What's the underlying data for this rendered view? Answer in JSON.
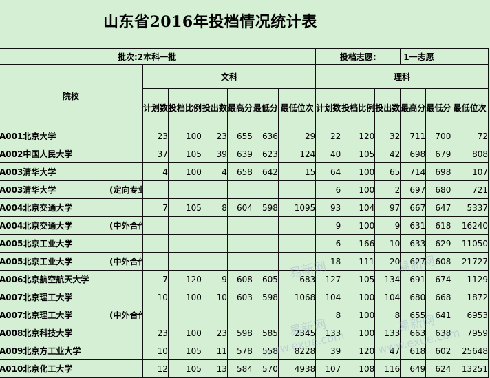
{
  "title": "山东省2016年投档情况统计表",
  "batch_label": "批次:2本科一批",
  "volunteer_label": "投档志愿:",
  "volunteer_value": "1一志愿",
  "school_header": "院校",
  "group_wenke": "文科",
  "group_like": "理科",
  "sub_headers": [
    "计划数",
    "投档比例",
    "投出数",
    "最高分",
    "最低分",
    "最低位次"
  ],
  "watermarks": [
    "易新网",
    "www.exue.com"
  ],
  "rows": [
    {
      "school": "A001北京大学",
      "note": "",
      "w": [
        "23",
        "100",
        "23",
        "655",
        "636",
        "29"
      ],
      "l": [
        "22",
        "120",
        "32",
        "711",
        "700",
        "72"
      ]
    },
    {
      "school": "A002中国人民大学",
      "note": "",
      "w": [
        "37",
        "105",
        "39",
        "639",
        "623",
        "124"
      ],
      "l": [
        "40",
        "105",
        "42",
        "698",
        "679",
        "808"
      ]
    },
    {
      "school": "A003清华大学",
      "note": "",
      "w": [
        "4",
        "100",
        "4",
        "658",
        "642",
        "15"
      ],
      "l": [
        "64",
        "100",
        "65",
        "714",
        "698",
        "107"
      ]
    },
    {
      "school": "A003清华大学",
      "note": "(定向专业)",
      "w": [
        "",
        "",
        "",
        "",
        "",
        ""
      ],
      "l": [
        "6",
        "100",
        "2",
        "697",
        "680",
        "721"
      ]
    },
    {
      "school": "A004北京交通大学",
      "note": "",
      "w": [
        "7",
        "105",
        "8",
        "604",
        "598",
        "1095"
      ],
      "l": [
        "93",
        "104",
        "97",
        "667",
        "647",
        "5337"
      ]
    },
    {
      "school": "A004北京交通大学",
      "note": "(中外合作)",
      "w": [
        "",
        "",
        "",
        "",
        "",
        ""
      ],
      "l": [
        "9",
        "100",
        "9",
        "631",
        "618",
        "16240"
      ]
    },
    {
      "school": "A005北京工业大学",
      "note": "",
      "w": [
        "",
        "",
        "",
        "",
        "",
        ""
      ],
      "l": [
        "6",
        "166",
        "10",
        "633",
        "629",
        "11050"
      ]
    },
    {
      "school": "A005北京工业大学",
      "note": "(中外合作)",
      "w": [
        "",
        "",
        "",
        "",
        "",
        ""
      ],
      "l": [
        "18",
        "111",
        "20",
        "627",
        "608",
        "21727"
      ]
    },
    {
      "school": "A006北京航空航天大学",
      "note": "",
      "w": [
        "7",
        "120",
        "9",
        "608",
        "605",
        "683"
      ],
      "l": [
        "127",
        "105",
        "134",
        "691",
        "674",
        "1129"
      ]
    },
    {
      "school": "A007北京理工大学",
      "note": "",
      "w": [
        "10",
        "100",
        "10",
        "603",
        "598",
        "1068"
      ],
      "l": [
        "104",
        "100",
        "104",
        "680",
        "668",
        "1872"
      ]
    },
    {
      "school": "A007北京理工大学",
      "note": "(中外合作)",
      "w": [
        "",
        "",
        "",
        "",
        "",
        ""
      ],
      "l": [
        "8",
        "100",
        "8",
        "655",
        "641",
        "6953"
      ]
    },
    {
      "school": "A008北京科技大学",
      "note": "",
      "w": [
        "23",
        "100",
        "23",
        "598",
        "585",
        "2345"
      ],
      "l": [
        "133",
        "100",
        "133",
        "663",
        "638",
        "7959"
      ]
    },
    {
      "school": "A009北京方工业大学",
      "note": "",
      "w": [
        "10",
        "105",
        "11",
        "578",
        "558",
        "8228"
      ],
      "l": [
        "39",
        "120",
        "47",
        "618",
        "602",
        "25648"
      ]
    },
    {
      "school": "A010北京化工大学",
      "note": "",
      "w": [
        "12",
        "105",
        "13",
        "584",
        "570",
        "4938"
      ],
      "l": [
        "107",
        "108",
        "116",
        "649",
        "624",
        "13251"
      ]
    }
  ]
}
